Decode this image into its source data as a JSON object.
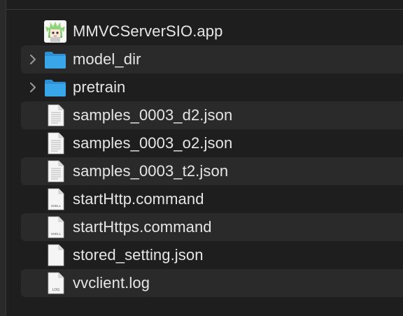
{
  "files": [
    {
      "name": "MMVCServerSIO.app",
      "icon": "app-icon",
      "disclosure": false
    },
    {
      "name": "model_dir",
      "icon": "folder-icon",
      "disclosure": true
    },
    {
      "name": "pretrain",
      "icon": "folder-icon",
      "disclosure": true
    },
    {
      "name": "samples_0003_d2.json",
      "icon": "document-icon",
      "disclosure": false
    },
    {
      "name": "samples_0003_o2.json",
      "icon": "document-icon",
      "disclosure": false
    },
    {
      "name": "samples_0003_t2.json",
      "icon": "document-icon",
      "disclosure": false
    },
    {
      "name": "startHttp.command",
      "icon": "shell-script-icon",
      "icon_text": "SHELL",
      "disclosure": false
    },
    {
      "name": "startHttps.command",
      "icon": "shell-script-icon",
      "icon_text": "SHELL",
      "disclosure": false
    },
    {
      "name": "stored_setting.json",
      "icon": "blank-document-icon",
      "disclosure": false
    },
    {
      "name": "vvclient.log",
      "icon": "log-file-icon",
      "icon_text": "LOG",
      "disclosure": false
    }
  ],
  "colors": {
    "background": "#1e1e1e",
    "row_alt": "#2a2a2a",
    "text": "#e6e6e6",
    "folder": "#3aa6ea",
    "app_character_hair": "#8fd47a"
  }
}
